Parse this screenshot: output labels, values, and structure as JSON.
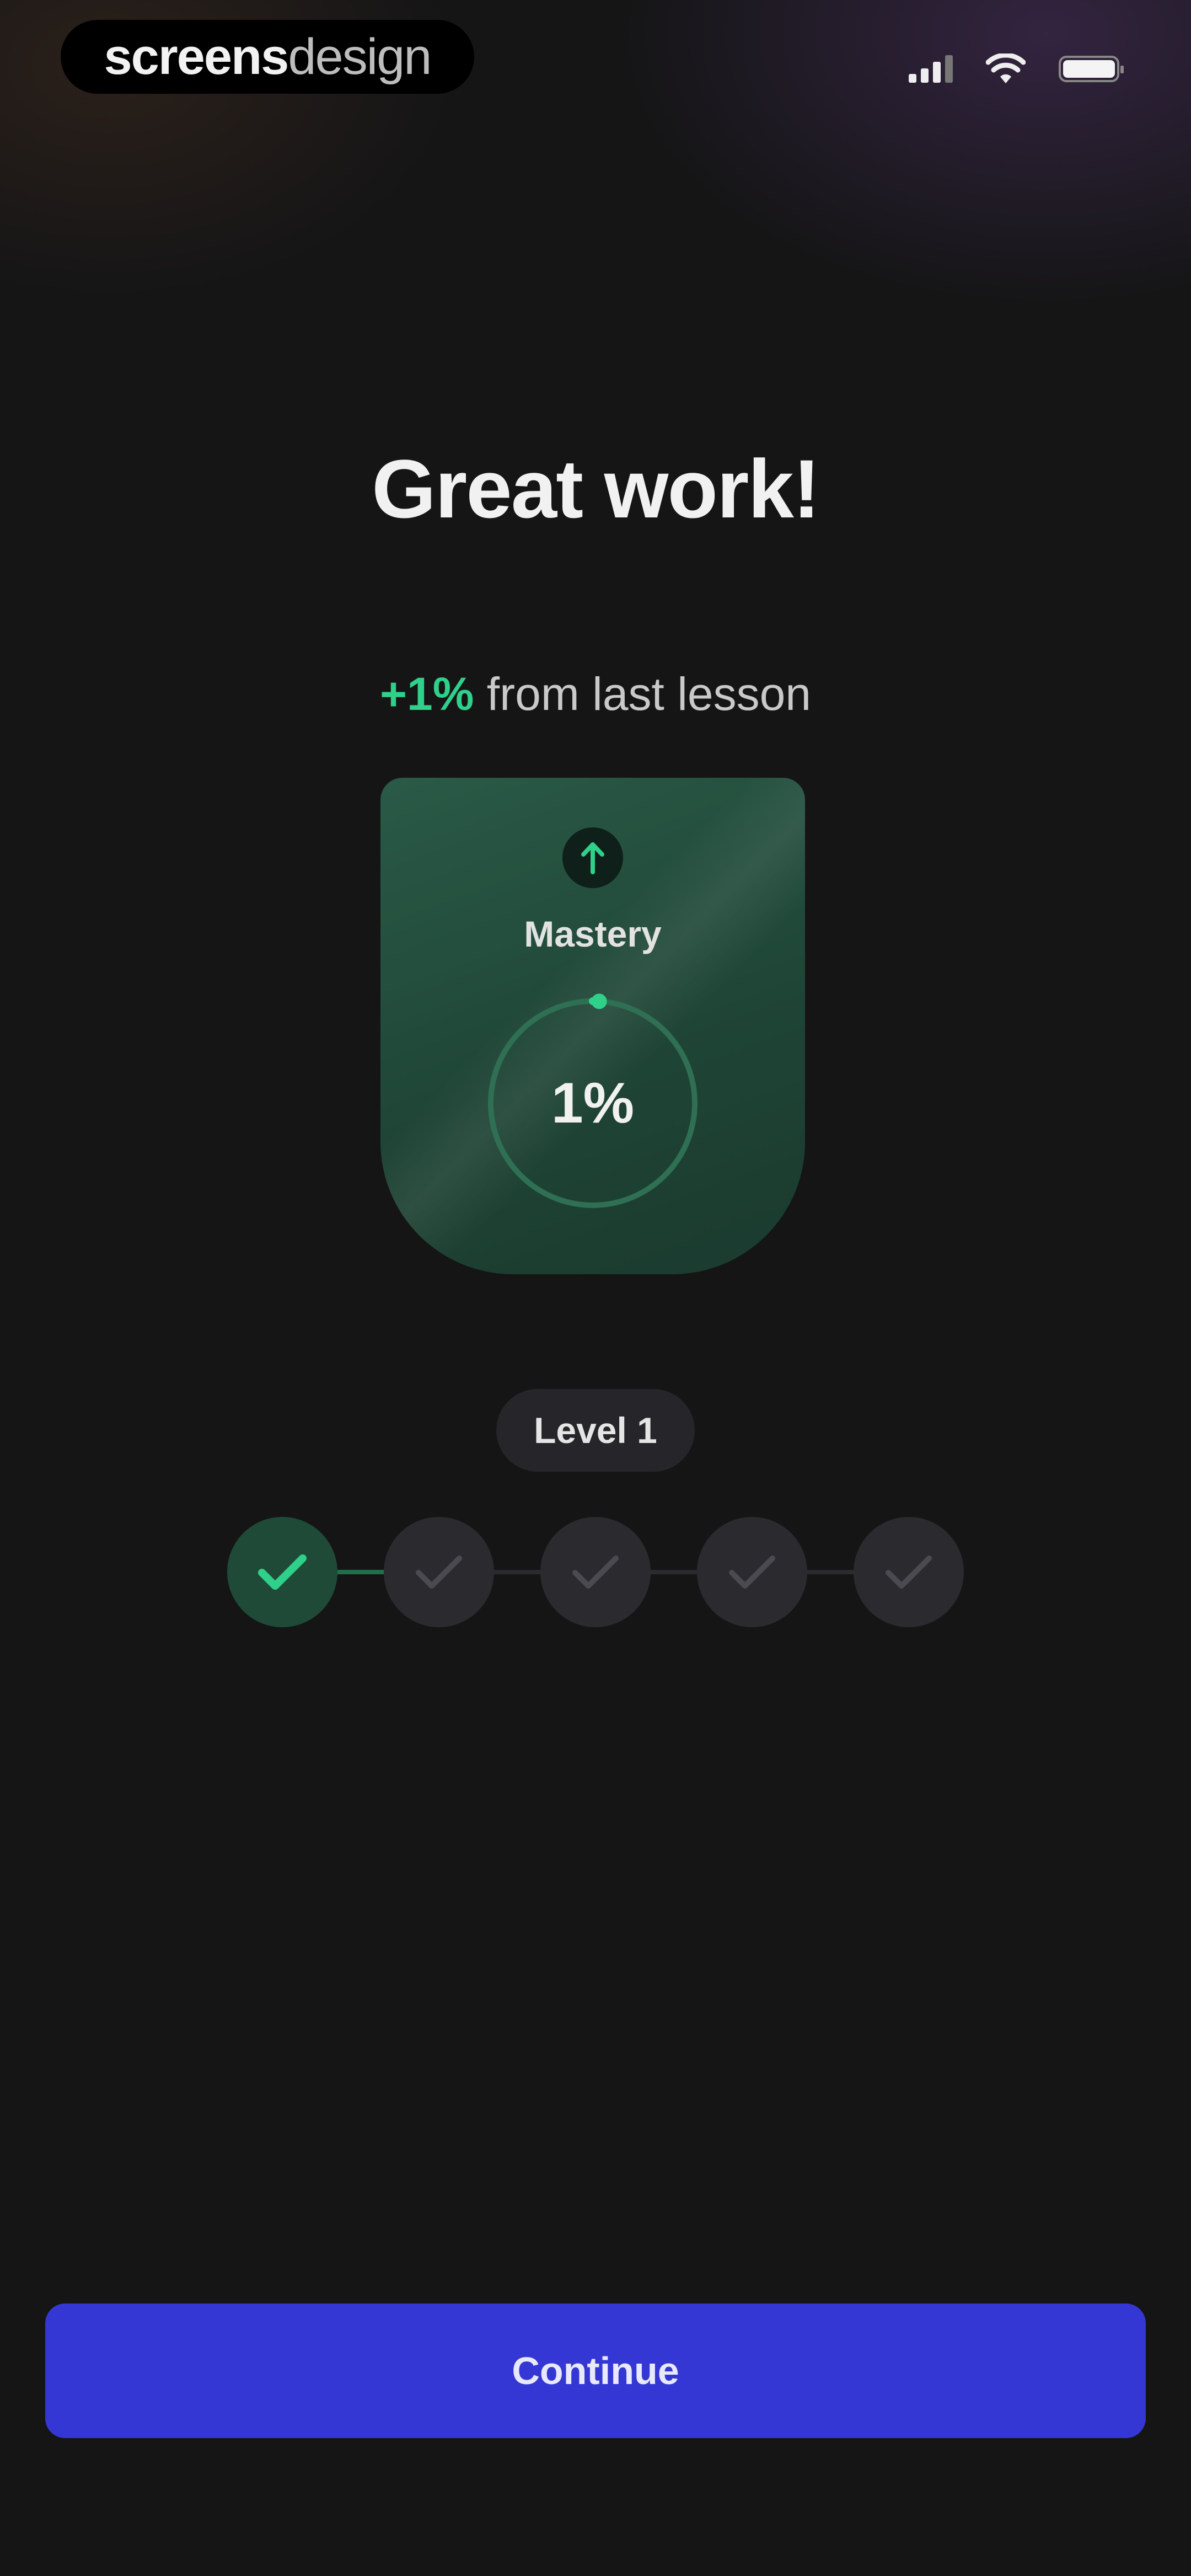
{
  "status_bar": {
    "brand_bold": "screens",
    "brand_light": "design"
  },
  "header": {
    "title": "Great work!",
    "delta_value": "+1%",
    "delta_text": "from last lesson"
  },
  "mastery_card": {
    "label": "Mastery",
    "value_text": "1%",
    "progress_fraction": 0.01,
    "badge_icon": "arrow-up-icon"
  },
  "level": {
    "label": "Level 1",
    "steps_completed": 1,
    "steps_total": 5
  },
  "actions": {
    "continue_label": "Continue"
  },
  "colors": {
    "accent_green": "#2fd089",
    "primary_button": "#3537d4",
    "background": "#151516"
  }
}
